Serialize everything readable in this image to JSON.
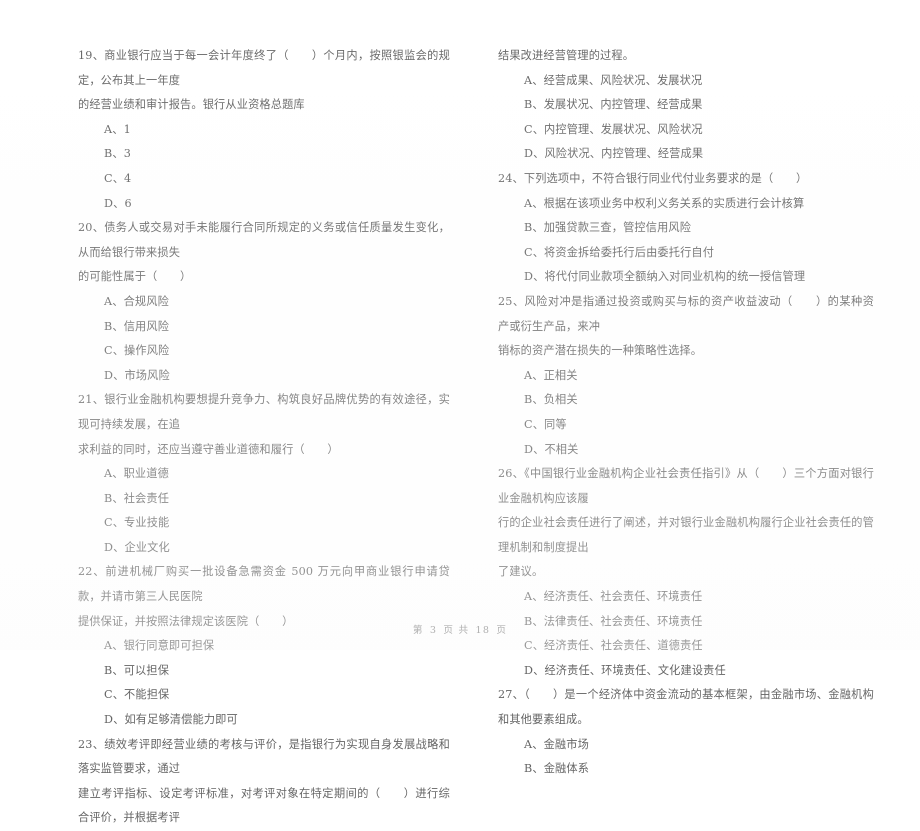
{
  "document": {
    "type": "scanned-exam-paper",
    "language": "zh-CN",
    "footer": {
      "page_label_prefix": "第",
      "page_number": "3",
      "page_label_middle": "页 共",
      "total_pages": "18",
      "page_label_suffix": "页",
      "full_text": "第 3 页 共 18 页"
    }
  },
  "left_column": {
    "questions": [
      {
        "number": "19",
        "stem_lines": [
          "19、商业银行应当于每一会计年度终了（　　）个月内，按照银监会的规定，公布其上一年度",
          "的经营业绩和审计报告。银行从业资格总题库"
        ],
        "options": [
          "A、1",
          "B、3",
          "C、4",
          "D、6"
        ]
      },
      {
        "number": "20",
        "stem_lines": [
          "20、债务人或交易对手未能履行合同所规定的义务或信任质量发生变化，从而给银行带来损失",
          "的可能性属于（　　）"
        ],
        "options": [
          "A、合规风险",
          "B、信用风险",
          "C、操作风险",
          "D、市场风险"
        ]
      },
      {
        "number": "21",
        "stem_lines": [
          "21、银行业金融机构要想提升竞争力、构筑良好品牌优势的有效途径，实现可持续发展，在追",
          "求利益的同时，还应当遵守善业道德和履行（　　）"
        ],
        "options": [
          "A、职业道德",
          "B、社会责任",
          "C、专业技能",
          "D、企业文化"
        ]
      },
      {
        "number": "22",
        "stem_lines": [
          "22、前进机械厂购买一批设备急需资金 500 万元向甲商业银行申请贷款，并请市第三人民医院",
          "提供保证，并按照法律规定该医院（　　）"
        ],
        "options": [
          "A、银行同意即可担保",
          "B、可以担保",
          "C、不能担保",
          "D、如有足够清偿能力即可"
        ]
      },
      {
        "number": "23",
        "stem_lines": [
          "23、绩效考评即经营业绩的考核与评价，是指银行为实现自身发展战略和落实监管要求，通过",
          "建立考评指标、设定考评标准，对考评对象在特定期间的（　　）进行综合评价，并根据考评"
        ],
        "options": []
      }
    ]
  },
  "right_column": {
    "questions": [
      {
        "number": "23-continued",
        "stem_lines": [
          "结果改进经营管理的过程。"
        ],
        "options": [
          "A、经营成果、风险状况、发展状况",
          "B、发展状况、内控管理、经营成果",
          "C、内控管理、发展状况、风险状况",
          "D、风险状况、内控管理、经营成果"
        ]
      },
      {
        "number": "24",
        "stem_lines": [
          "24、下列选项中，不符合银行同业代付业务要求的是（　　）"
        ],
        "options": [
          "A、根据在该项业务中权利义务关系的实质进行会计核算",
          "B、加强贷款三查，管控信用风险",
          "C、将资金拆给委托行后由委托行自付",
          "D、将代付同业款项全额纳入对同业机构的统一授信管理"
        ]
      },
      {
        "number": "25",
        "stem_lines": [
          "25、风险对冲是指通过投资或购买与标的资产收益波动（　　）的某种资产或衍生产品，来冲",
          "销标的资产潜在损失的一种策略性选择。"
        ],
        "options": [
          "A、正相关",
          "B、负相关",
          "C、同等",
          "D、不相关"
        ]
      },
      {
        "number": "26",
        "stem_lines": [
          "26、《中国银行业金融机构企业社会责任指引》从（　　）三个方面对银行业金融机构应该履",
          "行的企业社会责任进行了阐述，并对银行业金融机构履行企业社会责任的管理机制和制度提出",
          "了建议。"
        ],
        "options": [
          "A、经济责任、社会责任、环境责任",
          "B、法律责任、社会责任、环境责任",
          "C、经济责任、社会责任、道德责任",
          "D、经济责任、环境责任、文化建设责任"
        ]
      },
      {
        "number": "27",
        "stem_lines": [
          "27、（　　）是一个经济体中资金流动的基本框架，由金融市场、金融机构和其他要素组成。"
        ],
        "options": [
          "A、金融市场",
          "B、金融体系"
        ]
      }
    ]
  }
}
